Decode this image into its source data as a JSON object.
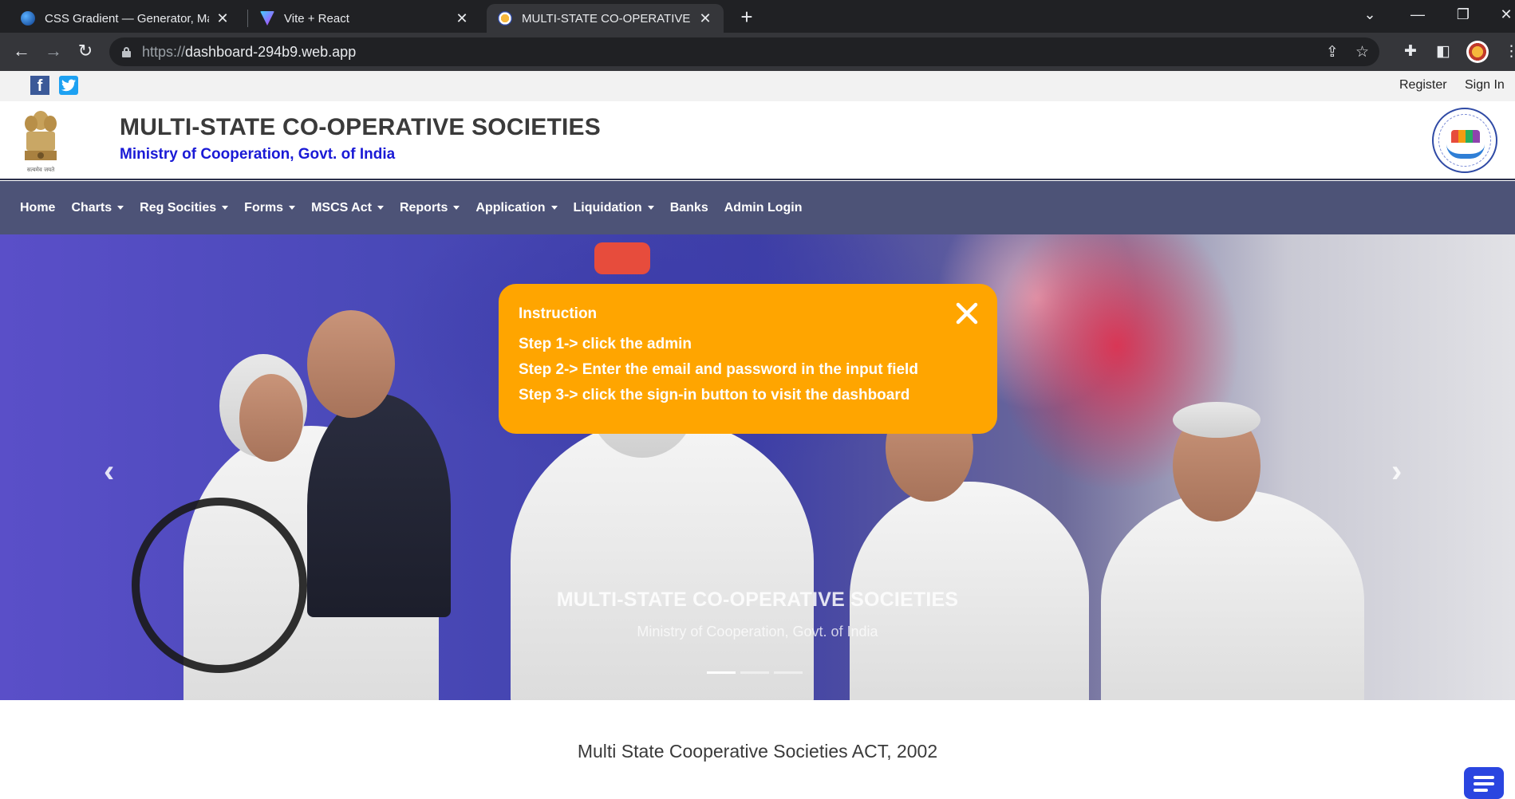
{
  "browser": {
    "tabs": [
      {
        "title": "CSS Gradient — Generator, Maker",
        "active": false,
        "favicon_color": "#2a7be4"
      },
      {
        "title": "Vite + React",
        "active": false,
        "favicon_color": "#a259ff"
      },
      {
        "title": "MULTI-STATE CO-OPERATIVE SOCIETIES",
        "active": true,
        "favicon_color": "#f6b73c"
      }
    ],
    "url_scheme": "https://",
    "url_host": "dashboard-294b9.web.app"
  },
  "topbar": {
    "register_label": "Register",
    "signin_label": "Sign In"
  },
  "header": {
    "title": "MULTI-STATE CO-OPERATIVE SOCIETIES",
    "subtitle": "Ministry of Cooperation, Govt. of India",
    "emblem_caption": "सत्यमेव जयते"
  },
  "nav": {
    "items": [
      {
        "label": "Home",
        "dropdown": false
      },
      {
        "label": "Charts",
        "dropdown": true
      },
      {
        "label": "Reg Socities",
        "dropdown": true
      },
      {
        "label": "Forms",
        "dropdown": true
      },
      {
        "label": "MSCS Act",
        "dropdown": true
      },
      {
        "label": "Reports",
        "dropdown": true
      },
      {
        "label": "Application",
        "dropdown": true
      },
      {
        "label": "Liquidation",
        "dropdown": true
      },
      {
        "label": "Banks",
        "dropdown": false
      },
      {
        "label": "Admin Login",
        "dropdown": false
      }
    ]
  },
  "carousel": {
    "caption_title": "MULTI-STATE CO-OPERATIVE SOCIETIES",
    "caption_subtitle": "Ministry of Cooperation, Govt. of India",
    "slide_count": 3,
    "active_slide": 1
  },
  "instruction": {
    "heading": "Instruction",
    "steps": [
      "Step 1-> click the admin",
      "Step 2-> Enter the email and password in the input field",
      "Step 3-> click the sign-in button to visit the dashboard"
    ]
  },
  "content": {
    "act_title": "Multi State Cooperative Societies ACT, 2002"
  }
}
